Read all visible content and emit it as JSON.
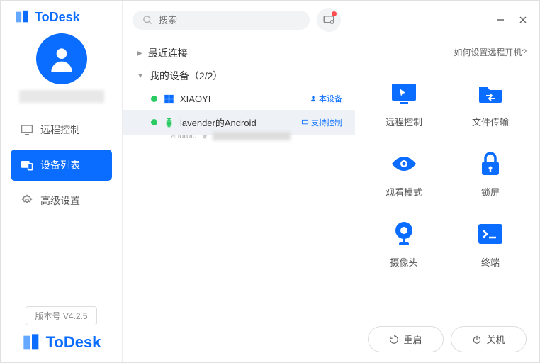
{
  "brand": "ToDesk",
  "search": {
    "placeholder": "搜索"
  },
  "sidebar": {
    "items": [
      {
        "label": "远程控制"
      },
      {
        "label": "设备列表"
      },
      {
        "label": "高级设置"
      }
    ],
    "version": "版本号 V4.2.5"
  },
  "groups": {
    "recent": {
      "label": "最近连接"
    },
    "mine": {
      "label": "我的设备（2/2）"
    }
  },
  "devices": [
    {
      "name": "XIAOYI",
      "tag": "本设备",
      "os": "windows"
    },
    {
      "name": "lavender的Android",
      "tag": "支持控制",
      "os": "android",
      "sub": "android"
    }
  ],
  "help_link": "如何设置远程开机?",
  "actions": [
    {
      "label": "远程控制"
    },
    {
      "label": "文件传输"
    },
    {
      "label": "观看模式"
    },
    {
      "label": "锁屏"
    },
    {
      "label": "摄像头"
    },
    {
      "label": "终端"
    }
  ],
  "buttons": {
    "restart": "重启",
    "shutdown": "关机"
  }
}
